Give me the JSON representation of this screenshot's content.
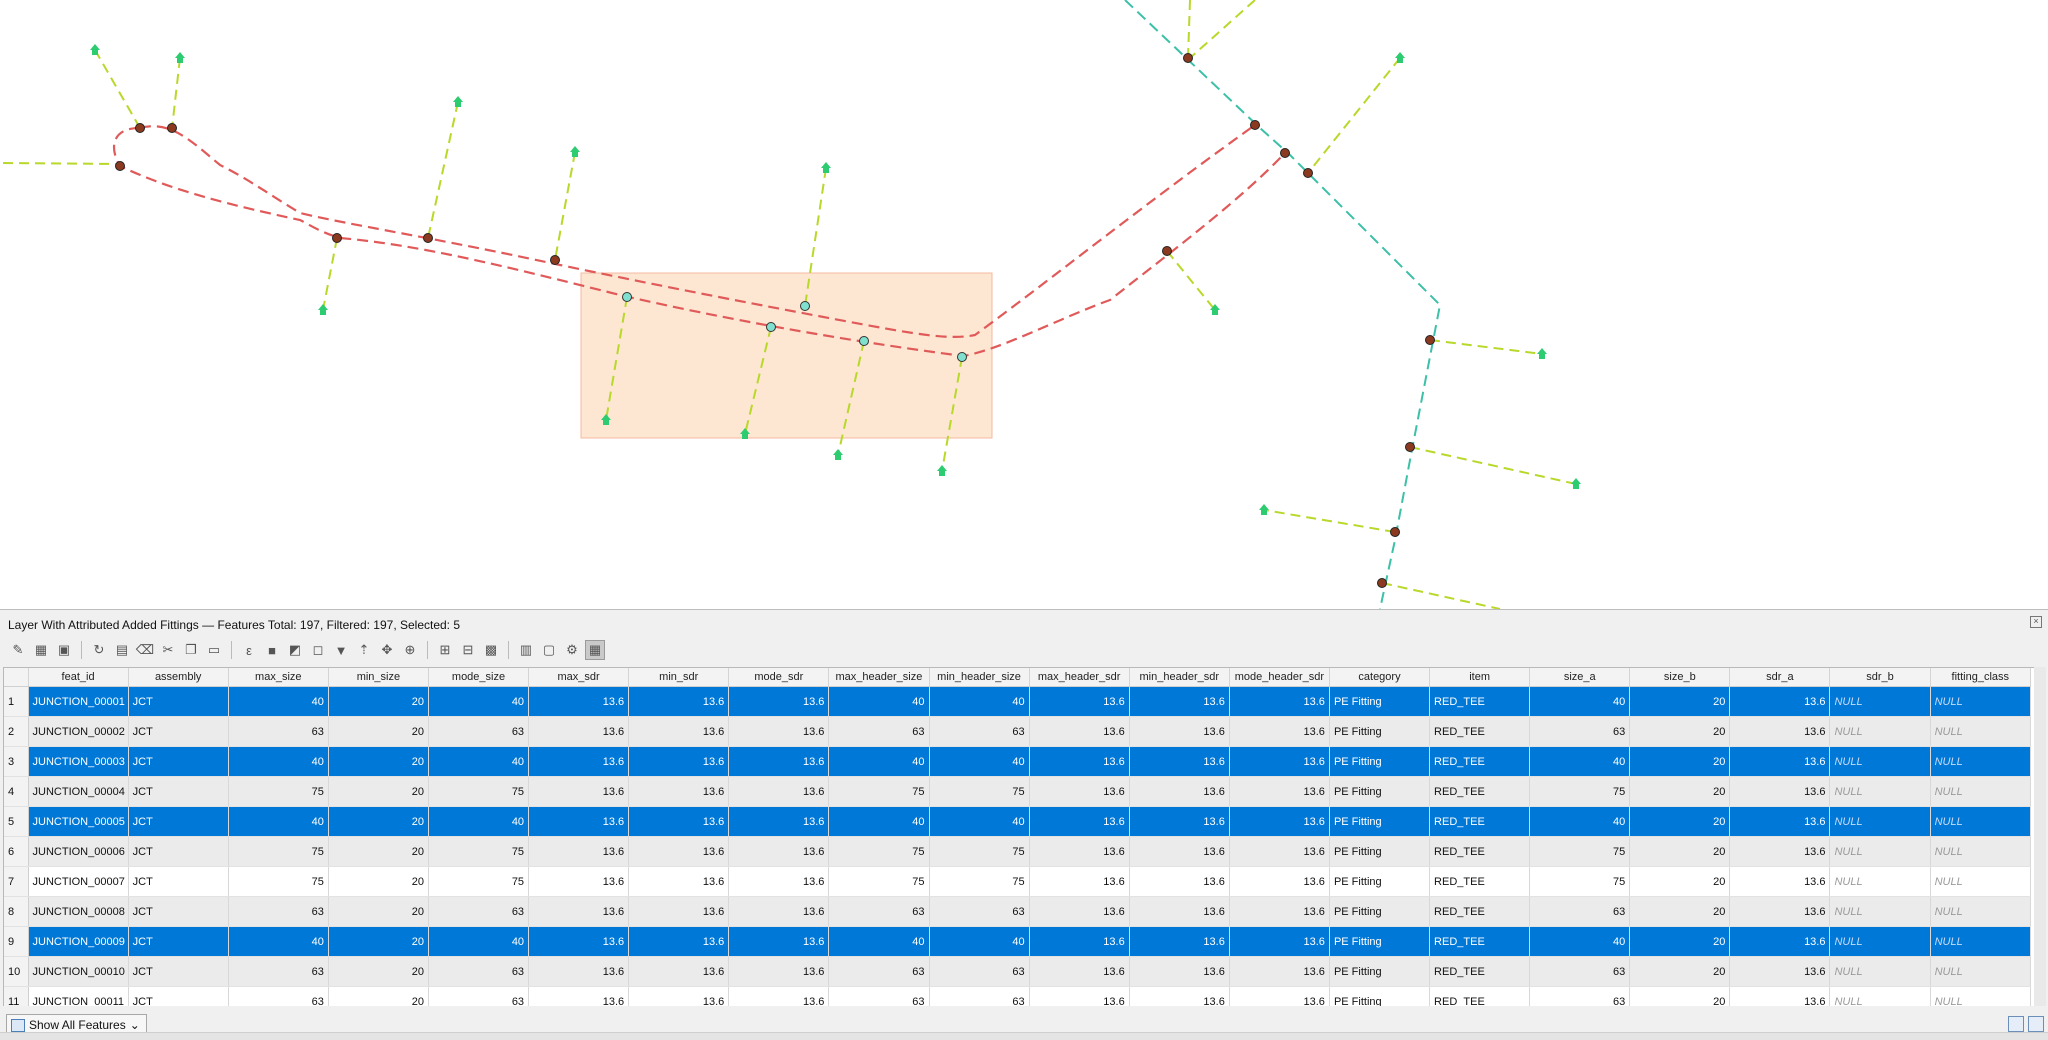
{
  "colors": {
    "pipe_red": "#e05a5a",
    "pipe_teal": "#3cc0a8",
    "service_line": "#b8d82a",
    "house": "#2ecc71",
    "junction": "#8b3a1f",
    "selected_fitting": "#7fe0d0",
    "selection_box": "#fde7d2",
    "selection_row": "#0078d7"
  },
  "panel": {
    "title": "Layer With Attributed Added Fittings — Features Total: 197, Filtered: 197, Selected: 5",
    "close_glyph": "×"
  },
  "toolbar": [
    {
      "name": "toggle-editing-icon",
      "glyph": "✎"
    },
    {
      "name": "multi-edit-icon",
      "glyph": "▦"
    },
    {
      "name": "save-edits-icon",
      "glyph": "▣"
    },
    {
      "name": "reload-icon",
      "glyph": "↻"
    },
    {
      "name": "add-feature-icon",
      "glyph": "▤"
    },
    {
      "name": "delete-feature-icon",
      "glyph": "⌫"
    },
    {
      "name": "cut-icon",
      "glyph": "✂"
    },
    {
      "name": "copy-icon",
      "glyph": "❐"
    },
    {
      "name": "paste-icon",
      "glyph": "▭"
    },
    {
      "name": "select-by-expression-icon",
      "glyph": "ε"
    },
    {
      "name": "select-all-icon",
      "glyph": "■"
    },
    {
      "name": "invert-selection-icon",
      "glyph": "◩"
    },
    {
      "name": "deselect-all-icon",
      "glyph": "◻"
    },
    {
      "name": "filter-icon",
      "glyph": "▼"
    },
    {
      "name": "move-selection-top-icon",
      "glyph": "⇡"
    },
    {
      "name": "pan-to-selection-icon",
      "glyph": "✥"
    },
    {
      "name": "zoom-to-selection-icon",
      "glyph": "⊕"
    },
    {
      "name": "new-field-icon",
      "glyph": "⊞"
    },
    {
      "name": "delete-field-icon",
      "glyph": "⊟"
    },
    {
      "name": "field-calculator-icon",
      "glyph": "▩"
    },
    {
      "name": "conditional-formatting-icon",
      "glyph": "▥"
    },
    {
      "name": "dock-icon",
      "glyph": "▢"
    },
    {
      "name": "actions-icon",
      "glyph": "⚙"
    },
    {
      "name": "table-view-icon",
      "glyph": "▦"
    }
  ],
  "table": {
    "columns": [
      "feat_id",
      "assembly",
      "max_size",
      "min_size",
      "mode_size",
      "max_sdr",
      "min_sdr",
      "mode_sdr",
      "max_header_size",
      "min_header_size",
      "max_header_sdr",
      "min_header_sdr",
      "mode_header_sdr",
      "category",
      "item",
      "size_a",
      "size_b",
      "sdr_a",
      "sdr_b",
      "fitting_class"
    ],
    "rows": [
      {
        "n": "1",
        "sel": true,
        "cells": [
          "JUNCTION_00001",
          "JCT",
          "40",
          "20",
          "40",
          "13.6",
          "13.6",
          "13.6",
          "40",
          "40",
          "13.6",
          "13.6",
          "13.6",
          "PE Fitting",
          "RED_TEE",
          "40",
          "20",
          "13.6",
          "NULL",
          "NULL"
        ]
      },
      {
        "n": "2",
        "sel": false,
        "cells": [
          "JUNCTION_00002",
          "JCT",
          "63",
          "20",
          "63",
          "13.6",
          "13.6",
          "13.6",
          "63",
          "63",
          "13.6",
          "13.6",
          "13.6",
          "PE Fitting",
          "RED_TEE",
          "63",
          "20",
          "13.6",
          "NULL",
          "NULL"
        ]
      },
      {
        "n": "3",
        "sel": true,
        "cells": [
          "JUNCTION_00003",
          "JCT",
          "40",
          "20",
          "40",
          "13.6",
          "13.6",
          "13.6",
          "40",
          "40",
          "13.6",
          "13.6",
          "13.6",
          "PE Fitting",
          "RED_TEE",
          "40",
          "20",
          "13.6",
          "NULL",
          "NULL"
        ]
      },
      {
        "n": "4",
        "sel": false,
        "cells": [
          "JUNCTION_00004",
          "JCT",
          "75",
          "20",
          "75",
          "13.6",
          "13.6",
          "13.6",
          "75",
          "75",
          "13.6",
          "13.6",
          "13.6",
          "PE Fitting",
          "RED_TEE",
          "75",
          "20",
          "13.6",
          "NULL",
          "NULL"
        ]
      },
      {
        "n": "5",
        "sel": true,
        "cells": [
          "JUNCTION_00005",
          "JCT",
          "40",
          "20",
          "40",
          "13.6",
          "13.6",
          "13.6",
          "40",
          "40",
          "13.6",
          "13.6",
          "13.6",
          "PE Fitting",
          "RED_TEE",
          "40",
          "20",
          "13.6",
          "NULL",
          "NULL"
        ]
      },
      {
        "n": "6",
        "sel": false,
        "cells": [
          "JUNCTION_00006",
          "JCT",
          "75",
          "20",
          "75",
          "13.6",
          "13.6",
          "13.6",
          "75",
          "75",
          "13.6",
          "13.6",
          "13.6",
          "PE Fitting",
          "RED_TEE",
          "75",
          "20",
          "13.6",
          "NULL",
          "NULL"
        ]
      },
      {
        "n": "7",
        "sel": false,
        "cells": [
          "JUNCTION_00007",
          "JCT",
          "75",
          "20",
          "75",
          "13.6",
          "13.6",
          "13.6",
          "75",
          "75",
          "13.6",
          "13.6",
          "13.6",
          "PE Fitting",
          "RED_TEE",
          "75",
          "20",
          "13.6",
          "NULL",
          "NULL"
        ]
      },
      {
        "n": "8",
        "sel": false,
        "cells": [
          "JUNCTION_00008",
          "JCT",
          "63",
          "20",
          "63",
          "13.6",
          "13.6",
          "13.6",
          "63",
          "63",
          "13.6",
          "13.6",
          "13.6",
          "PE Fitting",
          "RED_TEE",
          "63",
          "20",
          "13.6",
          "NULL",
          "NULL"
        ]
      },
      {
        "n": "9",
        "sel": true,
        "cells": [
          "JUNCTION_00009",
          "JCT",
          "40",
          "20",
          "40",
          "13.6",
          "13.6",
          "13.6",
          "40",
          "40",
          "13.6",
          "13.6",
          "13.6",
          "PE Fitting",
          "RED_TEE",
          "40",
          "20",
          "13.6",
          "NULL",
          "NULL"
        ]
      },
      {
        "n": "10",
        "sel": false,
        "cells": [
          "JUNCTION_00010",
          "JCT",
          "63",
          "20",
          "63",
          "13.6",
          "13.6",
          "13.6",
          "63",
          "63",
          "13.6",
          "13.6",
          "13.6",
          "PE Fitting",
          "RED_TEE",
          "63",
          "20",
          "13.6",
          "NULL",
          "NULL"
        ]
      },
      {
        "n": "11",
        "sel": false,
        "cells": [
          "JUNCTION_00011",
          "JCT",
          "63",
          "20",
          "63",
          "13.6",
          "13.6",
          "13.6",
          "63",
          "63",
          "13.6",
          "13.6",
          "13.6",
          "PE Fitting",
          "RED_TEE",
          "63",
          "20",
          "13.6",
          "NULL",
          "NULL"
        ]
      }
    ]
  },
  "bottom": {
    "filter_label": "Show All Features",
    "filter_arrow": "⌄"
  }
}
